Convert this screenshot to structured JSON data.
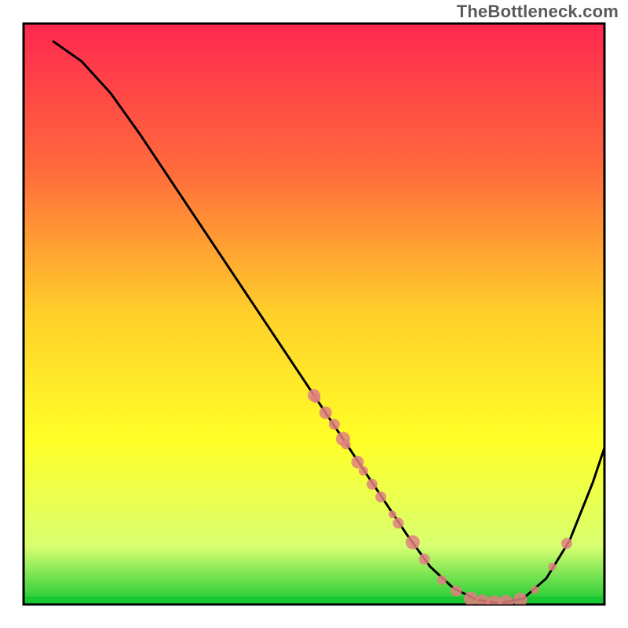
{
  "watermark": "TheBottleneck.com",
  "chart_data": {
    "type": "line",
    "title": "",
    "xlabel": "",
    "ylabel": "",
    "xlim": [
      0,
      100
    ],
    "ylim": [
      0,
      100
    ],
    "legend": false,
    "grid": false,
    "background_gradient": {
      "stops": [
        {
          "offset": 0.0,
          "color": "#ff2850"
        },
        {
          "offset": 0.25,
          "color": "#ff6a3c"
        },
        {
          "offset": 0.5,
          "color": "#ffd02a"
        },
        {
          "offset": 0.72,
          "color": "#ffff28"
        },
        {
          "offset": 0.9,
          "color": "#d8ff70"
        },
        {
          "offset": 1.0,
          "color": "#18c832"
        }
      ]
    },
    "series": [
      {
        "name": "curve",
        "color": "#000000",
        "x": [
          5,
          10,
          15,
          20,
          25,
          30,
          35,
          40,
          45,
          50,
          54,
          58,
          62,
          66,
          70,
          74,
          78,
          82,
          86,
          90,
          94,
          98,
          100
        ],
        "y": [
          97,
          93.5,
          88,
          81,
          73.5,
          66,
          58.5,
          51,
          43.5,
          36,
          30,
          24,
          18,
          12,
          6.5,
          2.8,
          0.8,
          0.2,
          1.0,
          4.5,
          11,
          21,
          27
        ]
      }
    ],
    "scatter_points": {
      "name": "markers",
      "color": "#e08080",
      "points": [
        {
          "x": 50.0,
          "y": 36.0,
          "r": 8
        },
        {
          "x": 50.3,
          "y": 35.5,
          "r": 6
        },
        {
          "x": 52.0,
          "y": 33.0,
          "r": 8
        },
        {
          "x": 53.5,
          "y": 31.0,
          "r": 7
        },
        {
          "x": 55.0,
          "y": 28.5,
          "r": 9
        },
        {
          "x": 55.5,
          "y": 27.5,
          "r": 6
        },
        {
          "x": 57.5,
          "y": 24.5,
          "r": 8
        },
        {
          "x": 58.5,
          "y": 23.0,
          "r": 6
        },
        {
          "x": 60.0,
          "y": 20.7,
          "r": 7
        },
        {
          "x": 61.5,
          "y": 18.5,
          "r": 7
        },
        {
          "x": 63.5,
          "y": 15.5,
          "r": 5
        },
        {
          "x": 64.5,
          "y": 14.0,
          "r": 7
        },
        {
          "x": 67.0,
          "y": 10.7,
          "r": 9
        },
        {
          "x": 69.0,
          "y": 7.8,
          "r": 7
        },
        {
          "x": 72.0,
          "y": 4.2,
          "r": 6
        },
        {
          "x": 74.5,
          "y": 2.3,
          "r": 7
        },
        {
          "x": 77.0,
          "y": 1.0,
          "r": 9
        },
        {
          "x": 79.0,
          "y": 0.5,
          "r": 9
        },
        {
          "x": 81.0,
          "y": 0.2,
          "r": 10
        },
        {
          "x": 83.0,
          "y": 0.3,
          "r": 10
        },
        {
          "x": 85.5,
          "y": 0.8,
          "r": 9
        },
        {
          "x": 88.0,
          "y": 2.5,
          "r": 5
        },
        {
          "x": 91.0,
          "y": 6.5,
          "r": 5
        },
        {
          "x": 93.5,
          "y": 10.5,
          "r": 7
        }
      ]
    }
  }
}
